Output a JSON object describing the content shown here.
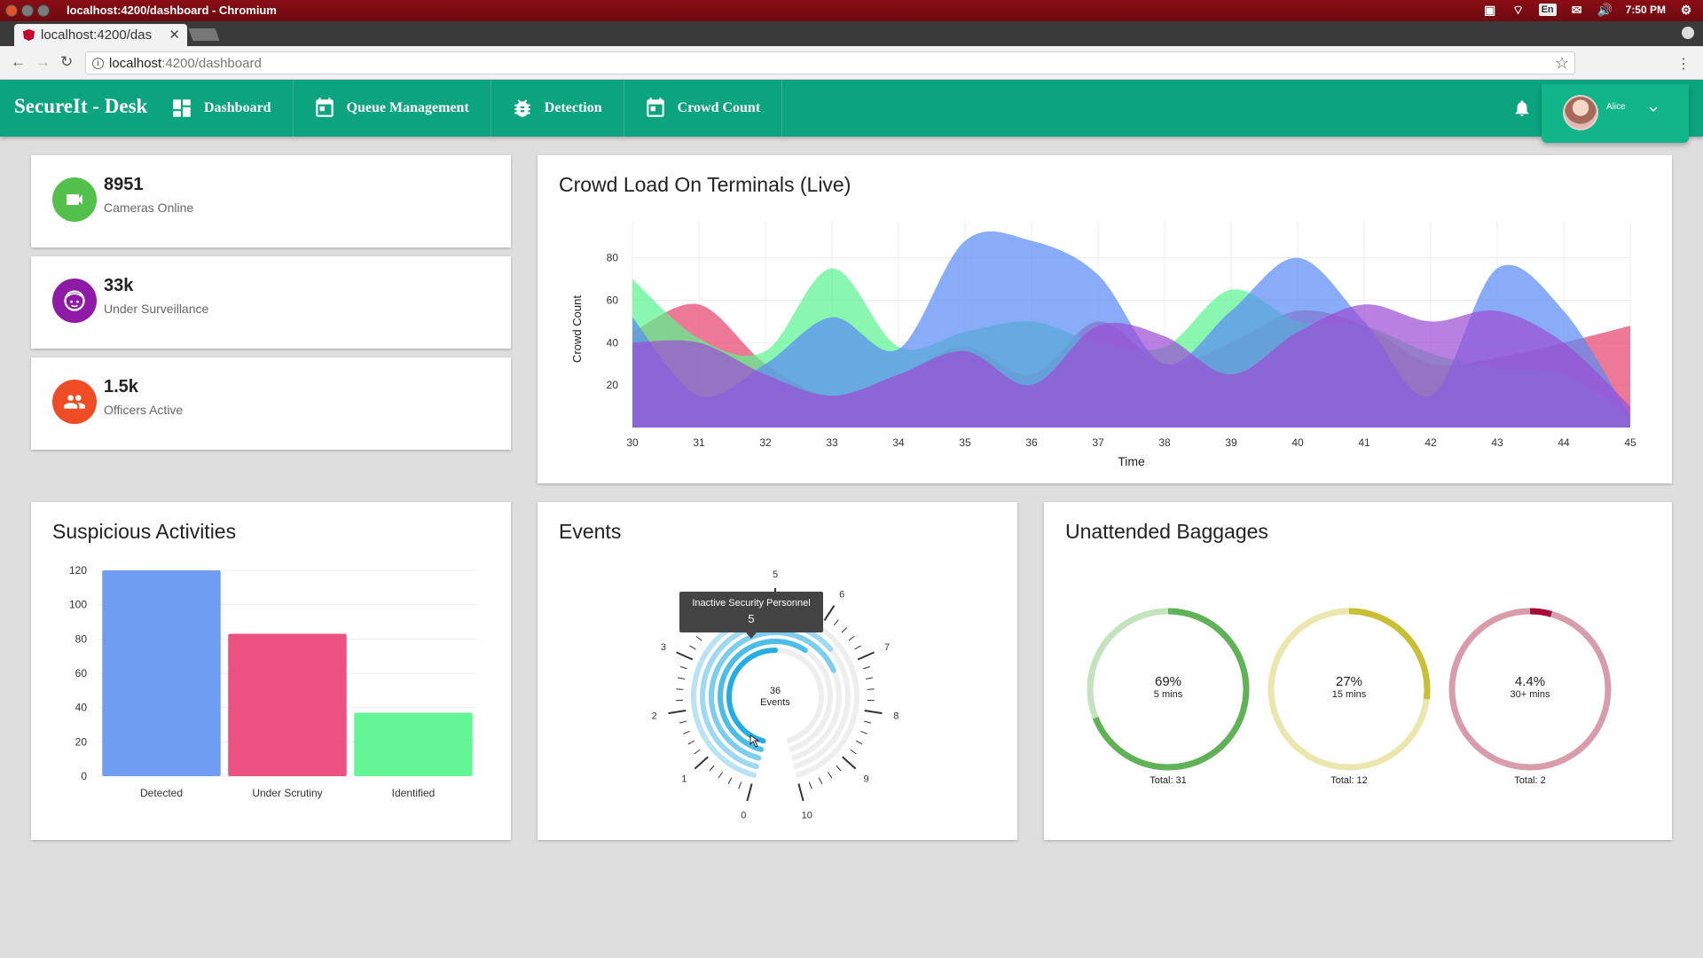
{
  "os": {
    "window_title": "localhost:4200/dashboard - Chromium",
    "language": "En",
    "time": "7:50 PM"
  },
  "browser": {
    "tab_title": "localhost:4200/das",
    "url_host": "localhost",
    "url_path": ":4200/dashboard"
  },
  "app": {
    "brand": "SecureIt - Desk",
    "nav": [
      {
        "label": "Dashboard",
        "icon": "dashboard-icon"
      },
      {
        "label": "Queue Management",
        "icon": "calendar-icon"
      },
      {
        "label": "Detection",
        "icon": "bug-icon"
      },
      {
        "label": "Crowd Count",
        "icon": "calendar-icon"
      }
    ],
    "user_name": "Alice",
    "colors": {
      "header": "#0ba47f",
      "user_box": "#10b588"
    }
  },
  "stats": [
    {
      "value": "8951",
      "label": "Cameras Online",
      "color": "#52c04b",
      "icon": "video-camera-icon"
    },
    {
      "value": "33k",
      "label": "Under Surveillance",
      "color": "#8e1aa7",
      "icon": "face-icon"
    },
    {
      "value": "1.5k",
      "label": "Officers Active",
      "color": "#ef4c26",
      "icon": "people-icon"
    }
  ],
  "crowd": {
    "title": "Crowd Load On Terminals (Live)",
    "chart_data": {
      "type": "area",
      "x": [
        30,
        31,
        32,
        33,
        34,
        35,
        36,
        37,
        38,
        39,
        40,
        41,
        42,
        43,
        44,
        45
      ],
      "xlabel": "Time",
      "ylabel": "Crowd Count",
      "yticks": [
        20,
        40,
        60,
        80
      ],
      "ylim": [
        0,
        97
      ],
      "grid": true,
      "series": [
        {
          "color": "#e8456d",
          "values": [
            45,
            58,
            30,
            15,
            25,
            38,
            25,
            50,
            30,
            40,
            55,
            48,
            30,
            33,
            40,
            48
          ]
        },
        {
          "color": "#5cf490",
          "values": [
            70,
            42,
            36,
            75,
            38,
            45,
            50,
            40,
            38,
            65,
            50,
            48,
            35,
            28,
            25,
            5
          ]
        },
        {
          "color": "#5a8cf4",
          "values": [
            52,
            15,
            30,
            52,
            37,
            88,
            88,
            72,
            30,
            55,
            80,
            50,
            15,
            75,
            55,
            5
          ]
        },
        {
          "color": "#9b4fd6",
          "values": [
            40,
            40,
            25,
            15,
            25,
            36,
            20,
            48,
            43,
            25,
            45,
            58,
            50,
            55,
            40,
            10
          ]
        }
      ]
    }
  },
  "suspicious": {
    "title": "Suspicious Activities",
    "chart_data": {
      "type": "bar",
      "categories": [
        "Detected",
        "Under Scrutiny",
        "Identified"
      ],
      "values": [
        120,
        83,
        37
      ],
      "colors": [
        "#6f9df2",
        "#ec5281",
        "#64f595"
      ],
      "yticks": [
        0,
        20,
        40,
        60,
        80,
        100,
        120
      ],
      "ylim": [
        0,
        120
      ],
      "grid": true
    }
  },
  "events": {
    "title": "Events",
    "total": "36",
    "total_label": "Events",
    "gauge_ticks": [
      "0",
      "1",
      "2",
      "3",
      "5",
      "6",
      "7",
      "8",
      "9",
      "10"
    ],
    "tooltip": {
      "label": "Inactive Security Personnel",
      "value": "5"
    },
    "chart_data": {
      "type": "radial-bar",
      "total": 36,
      "scale_max": 10,
      "rings": [
        {
          "value": 4.5,
          "color": "#b9e3f3"
        },
        {
          "value": 6.5,
          "color": "#9fd9f1"
        },
        {
          "value": 7.0,
          "color": "#7ccdee"
        },
        {
          "value": 6.0,
          "color": "#4cbde9"
        },
        {
          "value": 5.0,
          "color": "#23ade4"
        }
      ]
    }
  },
  "baggage": {
    "title": "Unattended Baggages",
    "donuts": [
      {
        "percent": "69%",
        "period": "5 mins",
        "total": "Total: 31",
        "fraction": 0.69,
        "color": "#5fb356",
        "track": "#c3e3bd"
      },
      {
        "percent": "27%",
        "period": "15 mins",
        "total": "Total: 12",
        "fraction": 0.27,
        "color": "#c8bf34",
        "track": "#ebe6ad"
      },
      {
        "percent": "4.4%",
        "period": "30+ mins",
        "total": "Total: 2",
        "fraction": 0.044,
        "color": "#a60e39",
        "track": "#d89cab"
      }
    ]
  }
}
